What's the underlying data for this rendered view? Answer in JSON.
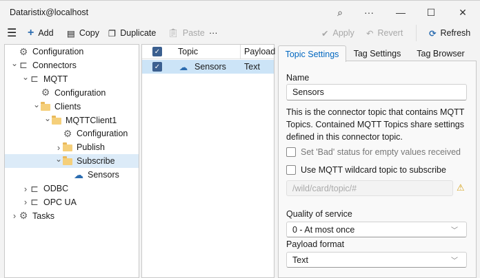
{
  "window": {
    "title": "Dataristix@localhost"
  },
  "toolbar": {
    "add": "Add",
    "copy": "Copy",
    "duplicate": "Duplicate",
    "paste": "Paste",
    "more": "···",
    "apply": "Apply",
    "revert": "Revert",
    "refresh": "Refresh"
  },
  "tree": [
    {
      "label": "Configuration",
      "level": 0,
      "chevron": "",
      "icon": "gear"
    },
    {
      "label": "Connectors",
      "level": 0,
      "chevron": "down",
      "icon": "plug"
    },
    {
      "label": "MQTT",
      "level": 1,
      "chevron": "down",
      "icon": "plug"
    },
    {
      "label": "Configuration",
      "level": 2,
      "chevron": "",
      "icon": "gear"
    },
    {
      "label": "Clients",
      "level": 2,
      "chevron": "down",
      "icon": "folder"
    },
    {
      "label": "MQTTClient1",
      "level": 3,
      "chevron": "down",
      "icon": "folder"
    },
    {
      "label": "Configuration",
      "level": 4,
      "chevron": "",
      "icon": "gear"
    },
    {
      "label": "Publish",
      "level": 4,
      "chevron": "right",
      "icon": "folder"
    },
    {
      "label": "Subscribe",
      "level": 4,
      "chevron": "down",
      "icon": "folder",
      "selected": true
    },
    {
      "label": "Sensors",
      "level": 5,
      "chevron": "",
      "icon": "cloud"
    },
    {
      "label": "ODBC",
      "level": 1,
      "chevron": "right",
      "icon": "plug"
    },
    {
      "label": "OPC UA",
      "level": 1,
      "chevron": "right",
      "icon": "plug"
    },
    {
      "label": "Tasks",
      "level": 0,
      "chevron": "right",
      "icon": "gears"
    }
  ],
  "list": {
    "columns": [
      "Topic",
      "Payload"
    ],
    "rows": [
      {
        "topic": "Sensors",
        "payload": "Text",
        "checked": true
      }
    ]
  },
  "tabs": [
    "Topic Settings",
    "Tag Settings",
    "Tag Browser"
  ],
  "settings": {
    "name_label": "Name",
    "name_value": "Sensors",
    "description": "This is the connector topic that contains MQTT Topics. Contained MQTT Topics share settings defined in this connector topic.",
    "bad_status_label": "Set 'Bad' status for empty values received",
    "wildcard_label": "Use MQTT wildcard topic to subscribe",
    "wildcard_placeholder": "/wild/card/topic/#",
    "qos_label": "Quality of service",
    "qos_value": "0 - At most once",
    "payload_label": "Payload format",
    "payload_value": "Text"
  },
  "colors": {
    "accent": "#0067c0",
    "selected_row": "#cce4f7",
    "checkbox": "#3b5f8f"
  }
}
